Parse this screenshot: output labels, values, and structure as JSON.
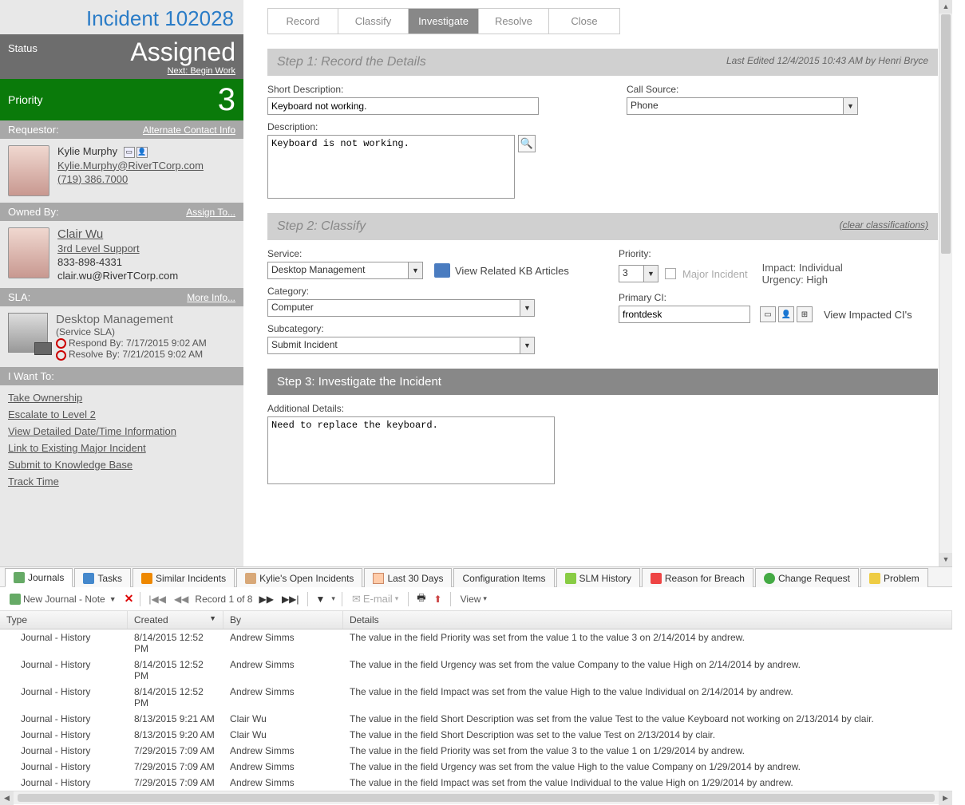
{
  "title": "Incident 102028",
  "status": {
    "label": "Status",
    "value": "Assigned",
    "next": "Next: Begin Work"
  },
  "priority": {
    "label": "Priority",
    "value": "3"
  },
  "requestor": {
    "header": "Requestor:",
    "alt_link": "Alternate Contact Info",
    "name": "Kylie Murphy",
    "email": "Kylie.Murphy@RiverTCorp.com",
    "phone": "(719) 386.7000"
  },
  "owned_by": {
    "header": "Owned By:",
    "assign_link": "Assign To...",
    "name": "Clair Wu",
    "team": "3rd Level Support",
    "phone": "833-898-4331",
    "email": "clair.wu@RiverTCorp.com"
  },
  "sla": {
    "header": "SLA:",
    "more": "More Info...",
    "name": "Desktop Management",
    "sub": "(Service SLA)",
    "respond": "Respond By: 7/17/2015 9:02 AM",
    "resolve": "Resolve By: 7/21/2015 9:02 AM"
  },
  "iwant": {
    "header": "I Want To:",
    "links": [
      "Take Ownership",
      "Escalate to Level 2",
      "View Detailed Date/Time Information",
      "Link to Existing Major Incident",
      "Submit to Knowledge Base",
      "Track Time"
    ]
  },
  "tabs": [
    "Record",
    "Classify",
    "Investigate",
    "Resolve",
    "Close"
  ],
  "active_tab": "Investigate",
  "step1": {
    "title": "Step 1:  Record the Details",
    "edited": "Last Edited 12/4/2015 10:43 AM by Henri Bryce",
    "short_desc_label": "Short Description:",
    "short_desc": "Keyboard not working.",
    "desc_label": "Description:",
    "desc": "Keyboard is not working.",
    "call_source_label": "Call Source:",
    "call_source": "Phone"
  },
  "step2": {
    "title": "Step 2:  Classify",
    "clear": "(clear classifications)",
    "service_label": "Service:",
    "service": "Desktop Management",
    "kb_link": "View Related KB Articles",
    "category_label": "Category:",
    "category": "Computer",
    "subcategory_label": "Subcategory:",
    "subcategory": "Submit Incident",
    "priority_label": "Priority:",
    "priority": "3",
    "major": "Major Incident",
    "impact": "Impact: Individual",
    "urgency": "Urgency: High",
    "primary_ci_label": "Primary CI:",
    "primary_ci": "frontdesk",
    "view_ci": "View Impacted CI's"
  },
  "step3": {
    "title": "Step 3:  Investigate the Incident",
    "addl_label": "Additional Details:",
    "addl": "Need to replace the keyboard."
  },
  "bottom_tabs": [
    "Journals",
    "Tasks",
    "Similar Incidents",
    "Kylie's Open Incidents",
    "Last 30 Days",
    "Configuration Items",
    "SLM History",
    "Reason for Breach",
    "Change Request",
    "Problem"
  ],
  "toolbar": {
    "new": "New Journal - Note",
    "record": "Record 1 of 8",
    "email": "E-mail",
    "view": "View"
  },
  "grid": {
    "headers": [
      "Type",
      "Created",
      "By",
      "Details"
    ],
    "rows": [
      {
        "type": "Journal - History",
        "created": "8/14/2015  12:52 PM",
        "by": "Andrew Simms",
        "details": "The value in the field Priority was set from the value 1 to the value 3 on 2/14/2014 by andrew."
      },
      {
        "type": "Journal - History",
        "created": "8/14/2015  12:52 PM",
        "by": "Andrew Simms",
        "details": "The value in the field Urgency was set from the value Company to the value High on 2/14/2014 by andrew."
      },
      {
        "type": "Journal - History",
        "created": "8/14/2015  12:52 PM",
        "by": "Andrew Simms",
        "details": "The value in the field Impact was set from the value High to the value Individual on 2/14/2014 by andrew."
      },
      {
        "type": "Journal - History",
        "created": "8/13/2015  9:21 AM",
        "by": "Clair Wu",
        "details": "The value in the field Short Description was set from the value Test to the value Keyboard not working on 2/13/2014 by clair."
      },
      {
        "type": "Journal - History",
        "created": "8/13/2015  9:20 AM",
        "by": "Clair Wu",
        "details": "The value in the field Short Description was set to the value Test on 2/13/2014 by clair."
      },
      {
        "type": "Journal - History",
        "created": "7/29/2015  7:09 AM",
        "by": "Andrew Simms",
        "details": "The value in the field Priority was set from the value 3 to the value 1 on 1/29/2014 by andrew."
      },
      {
        "type": "Journal - History",
        "created": "7/29/2015  7:09 AM",
        "by": "Andrew Simms",
        "details": "The value in the field Urgency was set from the value High to the value Company on 1/29/2014 by andrew."
      },
      {
        "type": "Journal - History",
        "created": "7/29/2015  7:09 AM",
        "by": "Andrew Simms",
        "details": "The value in the field Impact was set from the value Individual to the value High on 1/29/2014 by andrew."
      }
    ]
  }
}
